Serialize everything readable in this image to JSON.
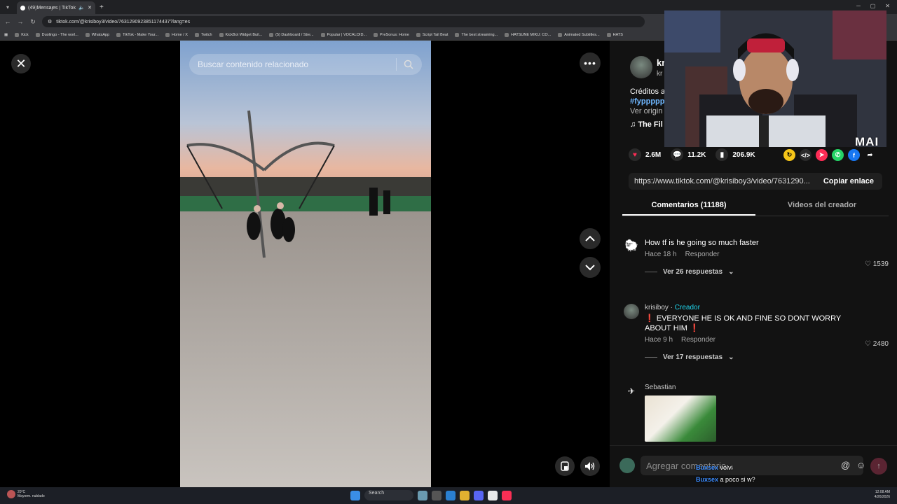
{
  "browser": {
    "tab_title": "(49)Mensajes | TikTok",
    "url": "tiktok.com/@krisiboy3/video/7631290923851174437?lang=es",
    "bookmarks": [
      "Kick",
      "Duolingo - The worl...",
      "WhatsApp",
      "TikTok - Make Your...",
      "Home / X",
      "Twitch",
      "KickBot Widget Buil...",
      "(5) Dashboard / Stre...",
      "Popular | VOCALOID...",
      "PreSonus: Home",
      "Script Tail Beat",
      "The best streaming...",
      "HATSUNE MIKU: CO...",
      "Animated Subtitles...",
      "HATS"
    ]
  },
  "player": {
    "search_placeholder": "Buscar contenido relacionado",
    "close_icon": "close-icon",
    "more_icon": "more-icon"
  },
  "creator": {
    "name": "kri",
    "handle": "kr",
    "desc_line1": "Créditos a",
    "hashtag": "#fyppppp",
    "see_original": "Ver origin",
    "music": "The Fil"
  },
  "actions": {
    "likes": "2.6M",
    "comments": "11.2K",
    "saves": "206.9K"
  },
  "link": {
    "url": "https://www.tiktok.com/@krisiboy3/video/7631290...",
    "copy_label": "Copiar enlace"
  },
  "tabs": {
    "comments": "Comentarios (11188)",
    "creator_videos": "Videos del creador"
  },
  "comments": [
    {
      "text": "How tf is he going so much faster",
      "time": "Hace 18 h",
      "reply": "Responder",
      "likes": "1539",
      "replies": "Ver 26 respuestas"
    },
    {
      "author": "krisiboy",
      "badge": "Creador",
      "text": "❗ EVERYONE HE IS OK AND FINE SO DONT WORRY ABOUT HIM ❗",
      "time": "Hace 9 h",
      "reply": "Responder",
      "likes": "2480",
      "replies": "Ver 17 respuestas"
    },
    {
      "author": "Sebastian"
    }
  ],
  "composer": {
    "placeholder": "Agregar comentario..."
  },
  "stream_chat": [
    {
      "user": "Buxsex",
      "msg": "volvi"
    },
    {
      "user": "Buxsex",
      "msg": "a poco si w?"
    }
  ],
  "overlay": {
    "brand": "MAI"
  },
  "taskbar": {
    "temp": "20°C",
    "weather": "Mayorm. nublado",
    "search": "Search",
    "time": "12:08 AM",
    "date": "4/26/2026"
  },
  "colors": {
    "heart": "#fe2c55",
    "creator_badge": "#20d5ec",
    "hashtag": "#6fb7ff"
  }
}
